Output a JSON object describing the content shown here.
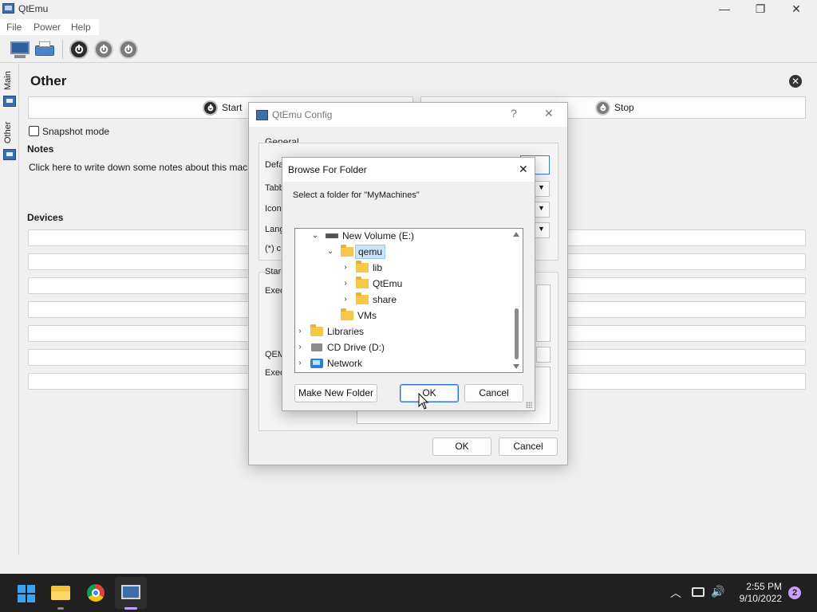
{
  "window": {
    "title": "QtEmu",
    "minimize": "—",
    "restore": "❐",
    "close": "✕"
  },
  "menu": {
    "items": [
      "File",
      "Power",
      "Help"
    ]
  },
  "sidebar": {
    "tabs": [
      "Main",
      "Other"
    ]
  },
  "page": {
    "title": "Other",
    "close_glyph": "✕",
    "start_label": "Start",
    "stop_label": "Stop",
    "snapshot_label": "Snapshot mode",
    "notes_heading": "Notes",
    "notes_text": "Click here to write down some notes about this machine.",
    "devices_heading": "Devices"
  },
  "config_dialog": {
    "title": "QtEmu Config",
    "help_glyph": "?",
    "close_glyph": "✕",
    "group_general": "General",
    "labels": [
      "Defa",
      "Tabb",
      "Icon",
      "Lang",
      "(*) c",
      "Star",
      "Exec",
      "QEM",
      "Exec"
    ],
    "ok_label": "OK",
    "cancel_label": "Cancel"
  },
  "browse_dialog": {
    "title": "Browse For Folder",
    "close_glyph": "✕",
    "prompt": "Select a folder for \"MyMachines\"",
    "tree": [
      {
        "label": "New Volume (E:)",
        "icon": "drive-icon",
        "chevron": "down"
      },
      {
        "label": "qemu",
        "icon": "folder-icon",
        "chevron": "down",
        "selected": true
      },
      {
        "label": "lib",
        "icon": "folder-icon",
        "chevron": "right"
      },
      {
        "label": "QtEmu",
        "icon": "folder-icon",
        "chevron": "right"
      },
      {
        "label": "share",
        "icon": "folder-icon",
        "chevron": "right"
      },
      {
        "label": "VMs",
        "icon": "folder-icon",
        "chevron": ""
      },
      {
        "label": "Libraries",
        "icon": "folder-icon",
        "chevron": "right"
      },
      {
        "label": "CD Drive (D:)",
        "icon": "cd-drive-icon",
        "chevron": "right"
      },
      {
        "label": "Network",
        "icon": "network-icon",
        "chevron": "right"
      }
    ],
    "make_folder_label": "Make New Folder",
    "ok_label": "OK",
    "cancel_label": "Cancel"
  },
  "taskbar": {
    "time": "2:55 PM",
    "date": "9/10/2022",
    "notifications": "2",
    "tray_icons": [
      "chevron-up-icon",
      "network-icon",
      "volume-icon"
    ]
  }
}
